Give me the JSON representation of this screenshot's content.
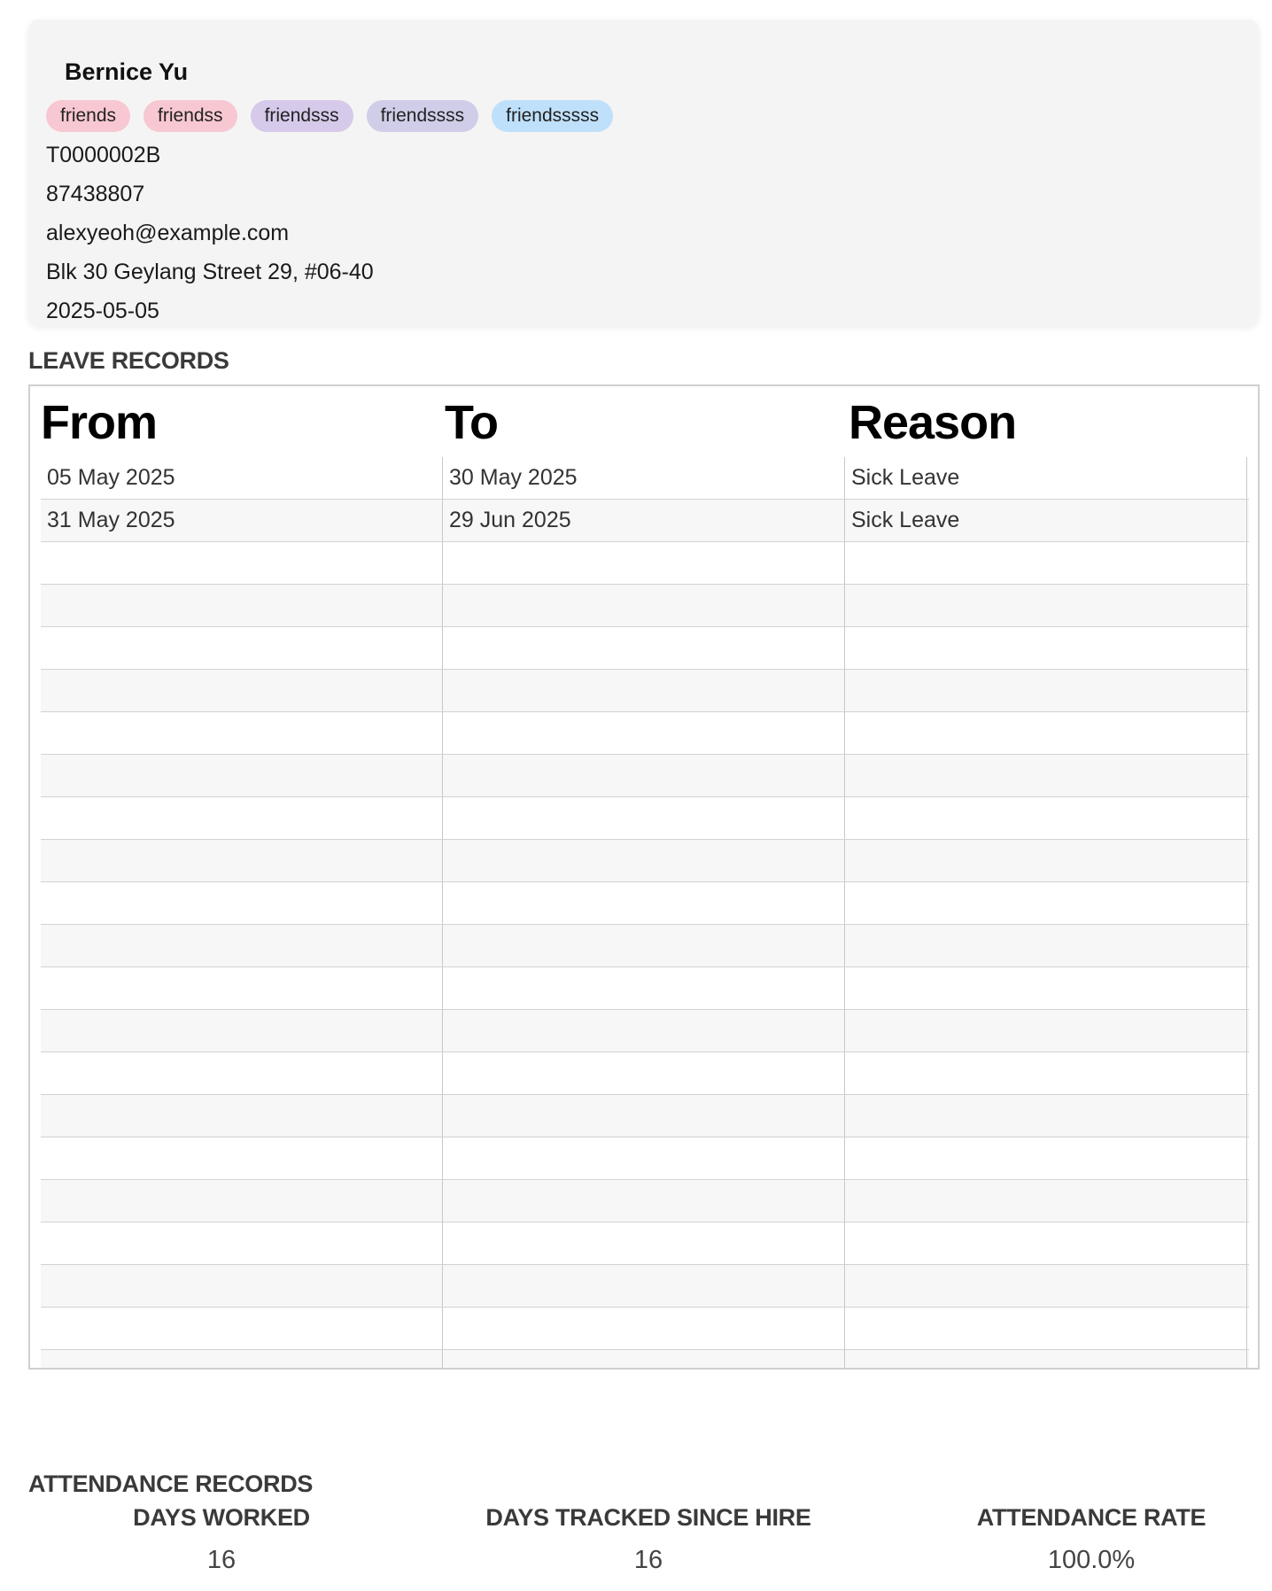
{
  "person": {
    "name": "Bernice Yu",
    "tags": [
      {
        "label": "friends",
        "color": "#f8c8d2"
      },
      {
        "label": "friendss",
        "color": "#f8c8d2"
      },
      {
        "label": "friendsss",
        "color": "#d6c9ea"
      },
      {
        "label": "friendssss",
        "color": "#cfcde8"
      },
      {
        "label": "friendsssss",
        "color": "#bfe0fb"
      }
    ],
    "nric": "T0000002B",
    "phone": "87438807",
    "email": "alexyeoh@example.com",
    "address": "Blk 30 Geylang Street 29, #06-40",
    "hire_date": "2025-05-05"
  },
  "leave": {
    "section_title": "LEAVE RECORDS",
    "columns": [
      "From",
      "To",
      "Reason"
    ],
    "rows": [
      [
        "05 May 2025",
        "30 May 2025",
        "Sick Leave"
      ],
      [
        "31 May 2025",
        "29 Jun 2025",
        "Sick Leave"
      ]
    ]
  },
  "attendance": {
    "section_title": "ATTENDANCE RECORDS",
    "days_worked_label": "DAYS WORKED",
    "days_worked": "16",
    "days_tracked_label": "DAYS TRACKED SINCE HIRE",
    "days_tracked": "16",
    "rate_label": "ATTENDANCE RATE",
    "rate": "100.0%"
  }
}
